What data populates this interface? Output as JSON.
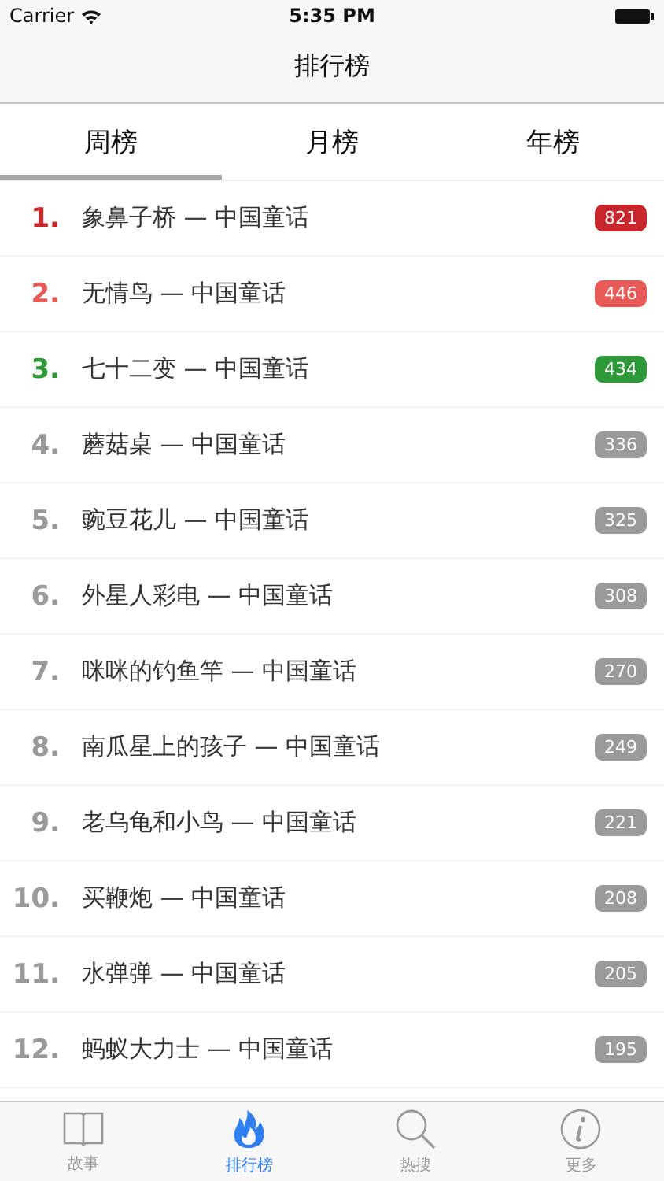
{
  "status_bar": {
    "carrier": "Carrier",
    "time": "5:35 PM"
  },
  "nav": {
    "title": "排行榜"
  },
  "tabs": [
    {
      "label": "周榜",
      "selected": true
    },
    {
      "label": "月榜",
      "selected": false
    },
    {
      "label": "年榜",
      "selected": false
    }
  ],
  "rows": [
    {
      "rank": "1.",
      "title": "象鼻子桥 — 中国童话",
      "count": "821",
      "color": "#c8262d"
    },
    {
      "rank": "2.",
      "title": "无情鸟 — 中国童话",
      "count": "446",
      "color": "#e65b58"
    },
    {
      "rank": "3.",
      "title": "七十二变 — 中国童话",
      "count": "434",
      "color": "#2e9938"
    },
    {
      "rank": "4.",
      "title": "蘑菇桌 — 中国童话",
      "count": "336",
      "color": "#9a9a9a"
    },
    {
      "rank": "5.",
      "title": "豌豆花儿 — 中国童话",
      "count": "325",
      "color": "#9a9a9a"
    },
    {
      "rank": "6.",
      "title": "外星人彩电 — 中国童话",
      "count": "308",
      "color": "#9a9a9a"
    },
    {
      "rank": "7.",
      "title": "咪咪的钓鱼竿 — 中国童话",
      "count": "270",
      "color": "#9a9a9a"
    },
    {
      "rank": "8.",
      "title": "南瓜星上的孩子 — 中国童话",
      "count": "249",
      "color": "#9a9a9a"
    },
    {
      "rank": "9.",
      "title": "老乌龟和小鸟 — 中国童话",
      "count": "221",
      "color": "#9a9a9a"
    },
    {
      "rank": "10.",
      "title": "买鞭炮 — 中国童话",
      "count": "208",
      "color": "#9a9a9a"
    },
    {
      "rank": "11.",
      "title": "水弹弹 — 中国童话",
      "count": "205",
      "color": "#9a9a9a"
    },
    {
      "rank": "12.",
      "title": "蚂蚁大力士 — 中国童话",
      "count": "195",
      "color": "#9a9a9a"
    }
  ],
  "tab_bar": [
    {
      "kind": "book",
      "label": "故事",
      "selected": false
    },
    {
      "kind": "flame",
      "label": "排行榜",
      "selected": true
    },
    {
      "kind": "search",
      "label": "热搜",
      "selected": false
    },
    {
      "kind": "info",
      "label": "更多",
      "selected": false
    }
  ]
}
